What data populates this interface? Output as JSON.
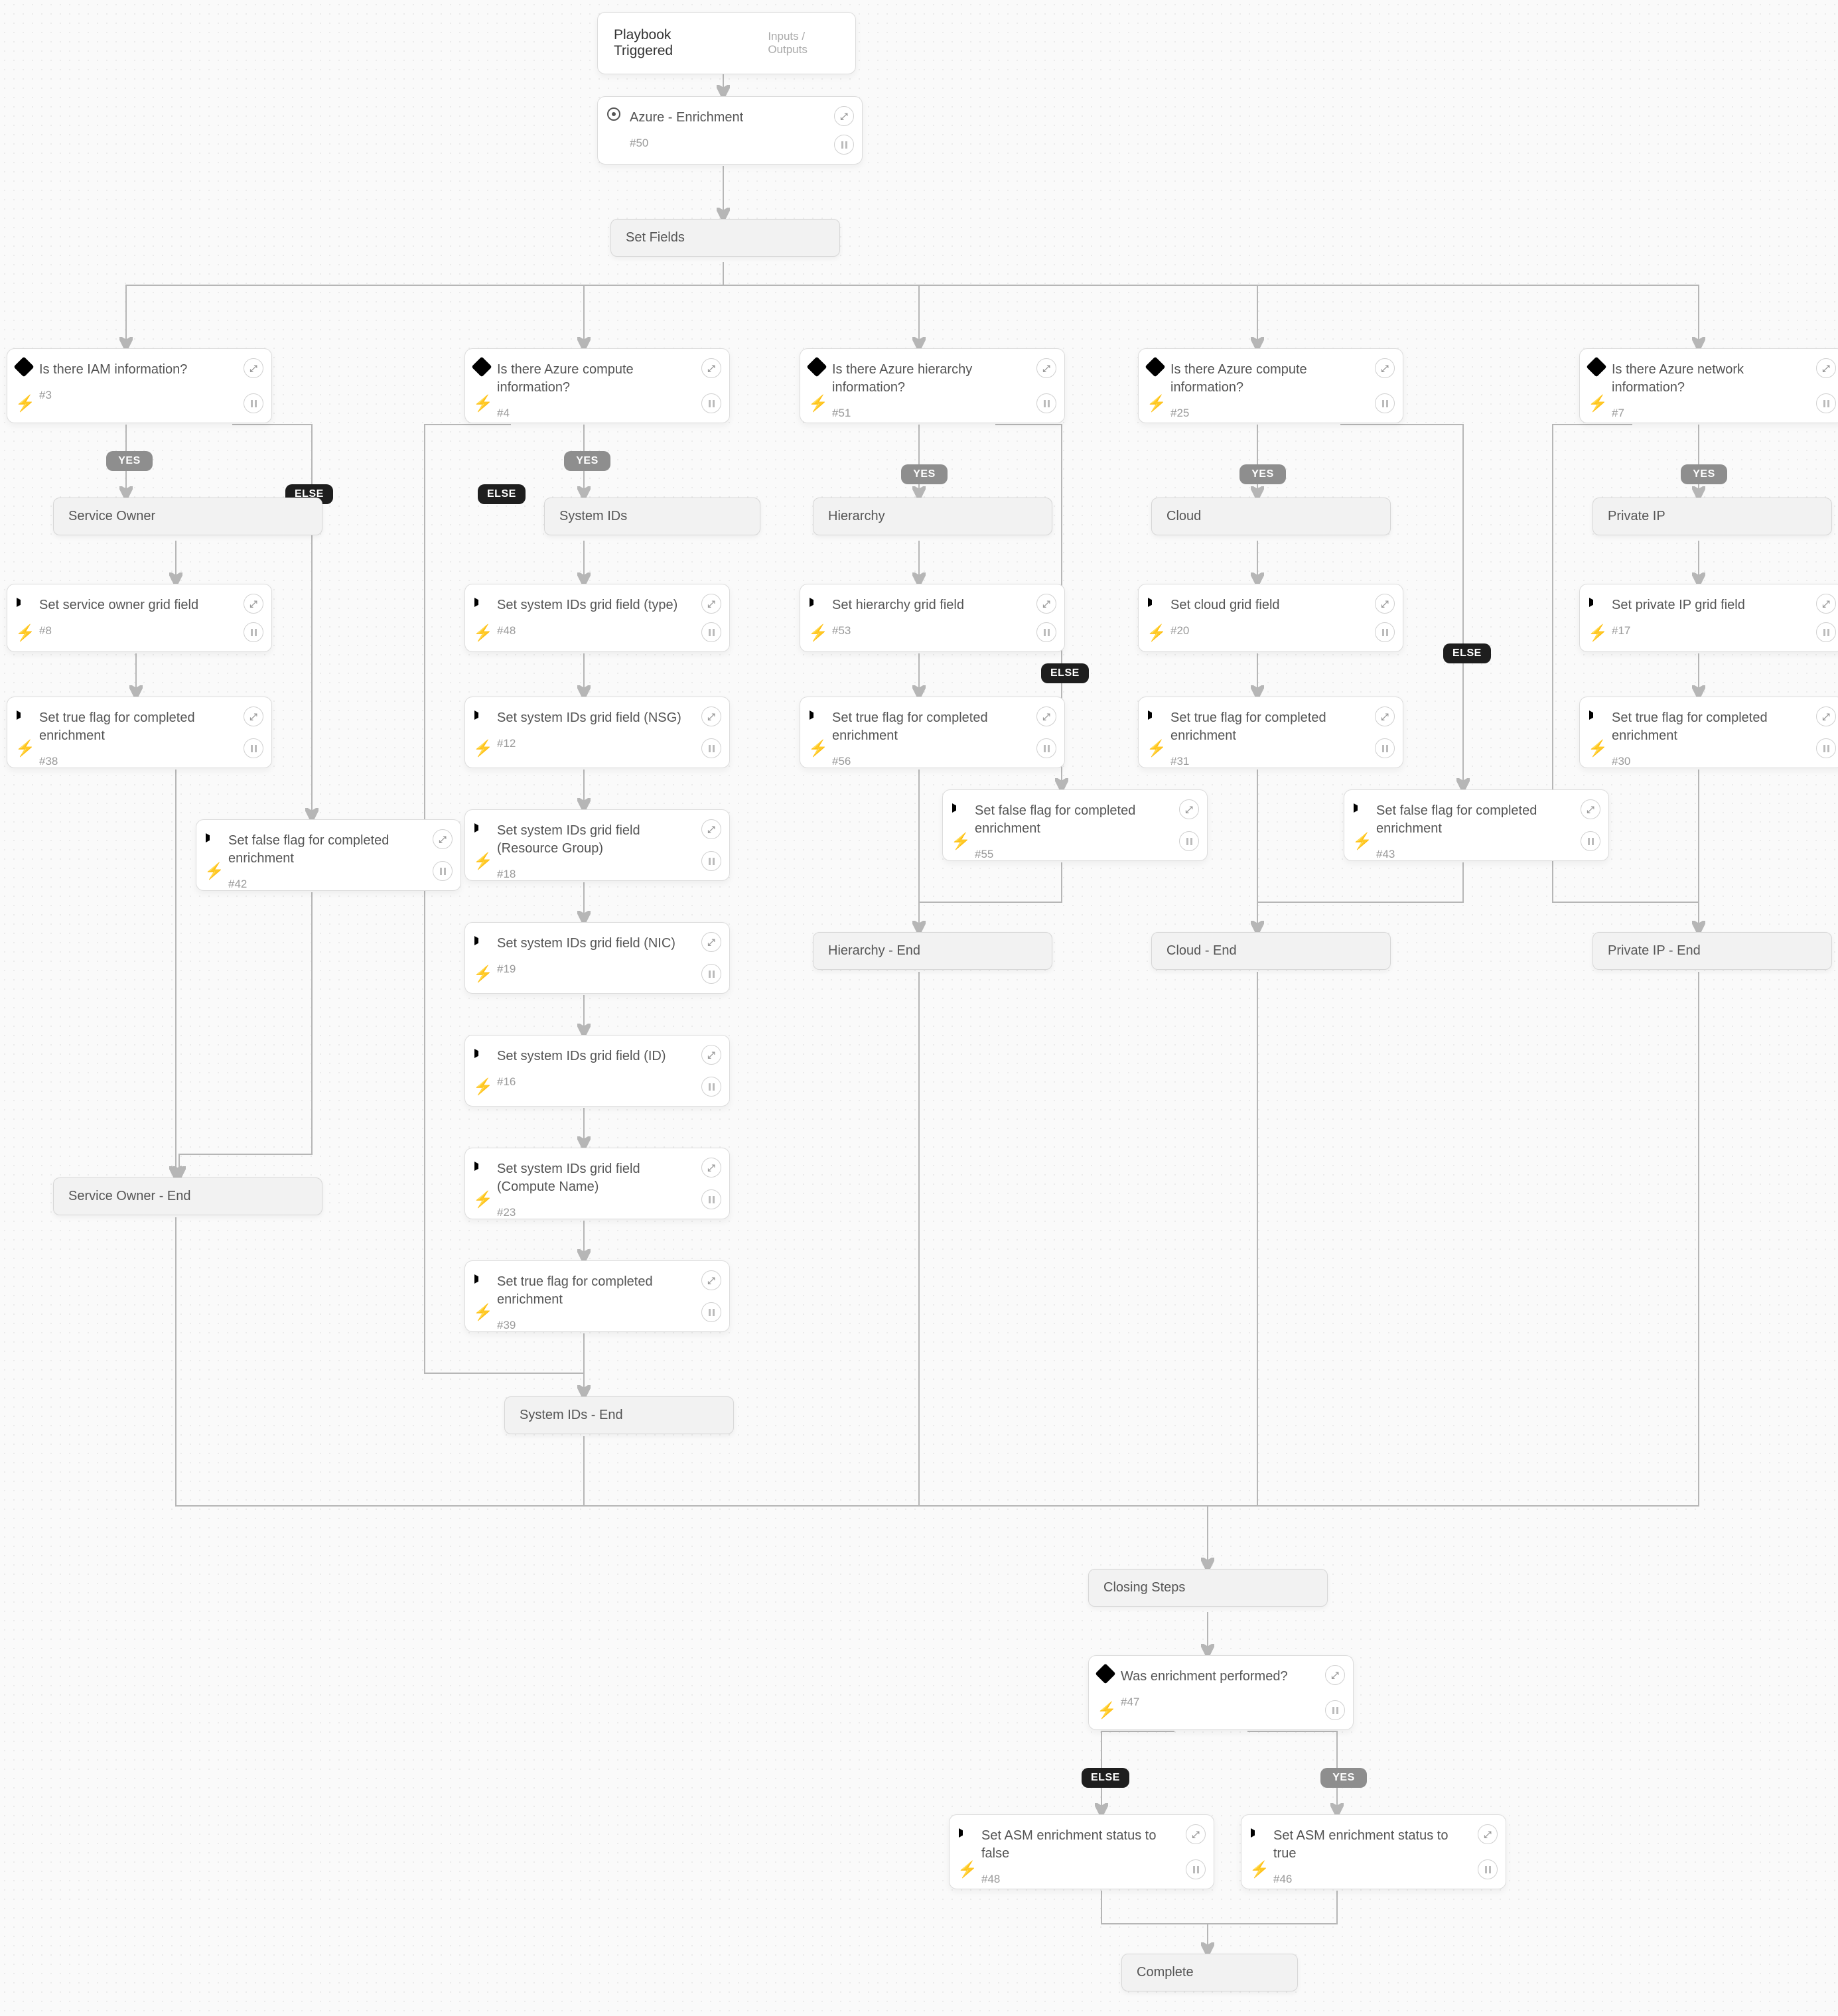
{
  "trigger": {
    "title": "Playbook Triggered",
    "io": "Inputs / Outputs"
  },
  "azure": {
    "title": "Azure - Enrichment",
    "id": "#50"
  },
  "set_fields": "Set Fields",
  "branches": {
    "iam": {
      "q": "Is there IAM information?",
      "id": "#3",
      "section": "Service Owner",
      "end": "Service Owner - End",
      "tasks": [
        {
          "title": "Set service owner grid field",
          "id": "#8"
        },
        {
          "title": "Set true flag for completed enrichment",
          "id": "#38"
        }
      ],
      "else": {
        "title": "Set false flag for completed enrichment",
        "id": "#42"
      }
    },
    "compute1": {
      "q": "Is there Azure compute information?",
      "id": "#4",
      "section": "System IDs",
      "end": "System IDs - End",
      "tasks": [
        {
          "title": "Set system IDs grid field (type)",
          "id": "#48"
        },
        {
          "title": "Set system IDs grid field (NSG)",
          "id": "#12"
        },
        {
          "title": "Set system IDs grid field (Resource Group)",
          "id": "#18"
        },
        {
          "title": "Set system IDs grid field (NIC)",
          "id": "#19"
        },
        {
          "title": "Set system IDs grid field (ID)",
          "id": "#16"
        },
        {
          "title": "Set system IDs grid field (Compute Name)",
          "id": "#23"
        },
        {
          "title": "Set true flag for completed enrichment",
          "id": "#39"
        }
      ]
    },
    "hierarchy": {
      "q": "Is there Azure hierarchy information?",
      "id": "#51",
      "section": "Hierarchy",
      "end": "Hierarchy - End",
      "tasks": [
        {
          "title": "Set hierarchy grid field",
          "id": "#53"
        },
        {
          "title": "Set true flag for completed enrichment",
          "id": "#56"
        }
      ],
      "else": {
        "title": "Set false flag for completed enrichment",
        "id": "#55"
      }
    },
    "compute2": {
      "q": "Is there Azure compute information?",
      "id": "#25",
      "section": "Cloud",
      "end": "Cloud - End",
      "tasks": [
        {
          "title": "Set cloud grid field",
          "id": "#20"
        },
        {
          "title": "Set true flag for completed enrichment",
          "id": "#31"
        }
      ],
      "else": {
        "title": "Set false flag for completed enrichment",
        "id": "#43"
      }
    },
    "network": {
      "q": "Is there Azure network information?",
      "id": "#7",
      "section": "Private IP",
      "end": "Private IP - End",
      "tasks": [
        {
          "title": "Set private IP grid field",
          "id": "#17"
        },
        {
          "title": "Set true flag for completed enrichment",
          "id": "#30"
        }
      ]
    }
  },
  "closing": {
    "section": "Closing Steps",
    "q": {
      "title": "Was enrichment performed?",
      "id": "#47"
    },
    "false": {
      "title": "Set ASM enrichment status to false",
      "id": "#48"
    },
    "true": {
      "title": "Set ASM enrichment status to true",
      "id": "#46"
    },
    "complete": "Complete"
  },
  "labels": {
    "yes": "YES",
    "else": "ELSE",
    "expand": "⤢"
  }
}
